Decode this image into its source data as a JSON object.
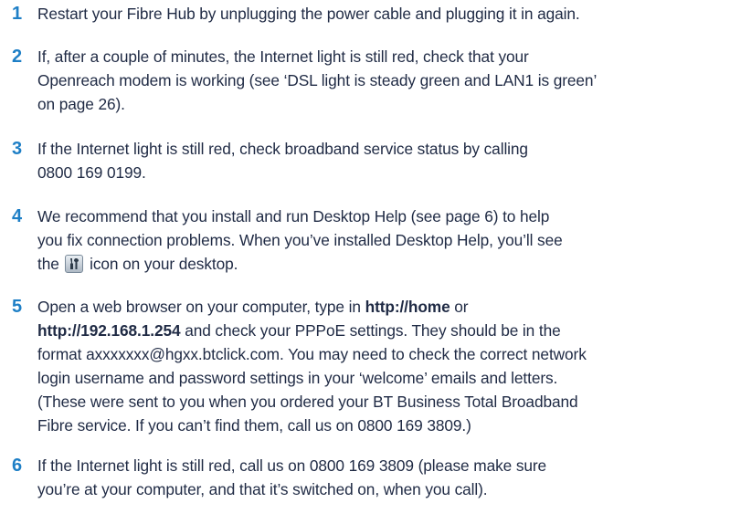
{
  "theme": {
    "accent": "#1e7fc6",
    "text": "#1f2a44"
  },
  "steps": [
    {
      "number": "1",
      "lines": [
        "Restart your Fibre Hub by unplugging the power cable and plugging it in again."
      ]
    },
    {
      "number": "2",
      "lines": [
        "If, after a couple of minutes, the Internet light is still red, check that your",
        "Openreach modem is working (see ‘DSL light is steady green and LAN1 is green’",
        "on page 26)."
      ]
    },
    {
      "number": "3",
      "lines": [
        "If the Internet light is still red, check broadband service status by calling",
        "0800 169 0199."
      ]
    },
    {
      "number": "4",
      "lines": [
        "We recommend that you install and run Desktop Help (see page 6) to help",
        "you fix connection problems. When you’ve installed Desktop Help, you’ll see"
      ],
      "line3_before": "the",
      "line3_after": "icon on your desktop.",
      "icon": "desktop-help-tools-icon"
    },
    {
      "number": "5",
      "line1_before": "Open a web browser on your computer, type in ",
      "line1_bold": "http://home",
      "line1_after": " or",
      "line2_bold": "http://192.168.1.254",
      "line2_after": " and check your PPPoE settings. They should be in the",
      "lines": [
        "format axxxxxxx@hgxx.btclick.com. You may need to check the correct network",
        "login username and password settings in your ‘welcome’ emails and letters.",
        "(These were sent to you when you ordered your BT Business Total Broadband",
        "Fibre service. If you can’t find them, call us on 0800 169 3809.)"
      ]
    },
    {
      "number": "6",
      "lines": [
        "If the Internet light is still red, call us on 0800 169 3809 (please make sure",
        "you’re at your computer, and that it’s switched on, when you call)."
      ]
    }
  ]
}
